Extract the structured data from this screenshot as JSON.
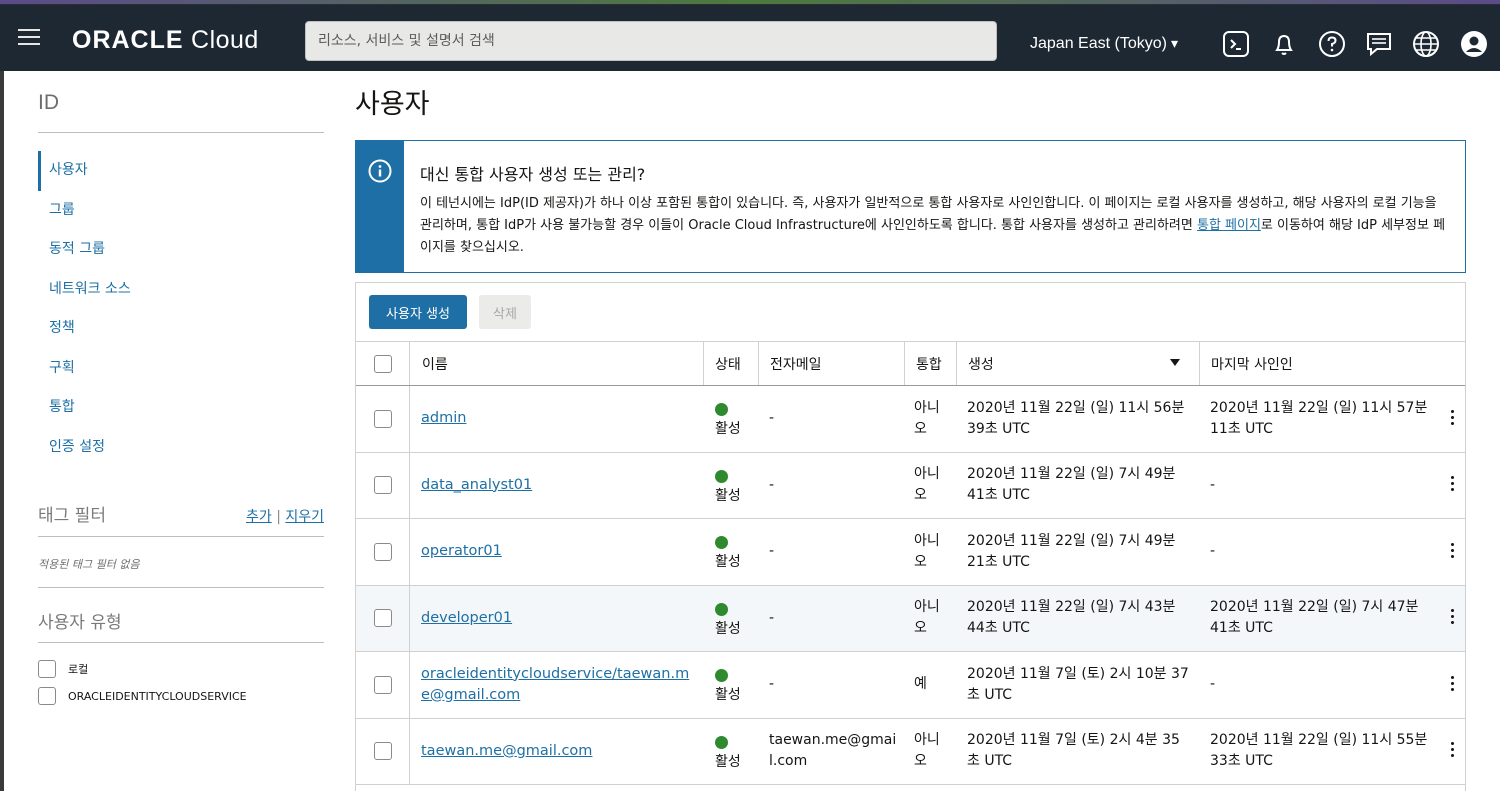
{
  "header": {
    "brand_strong": "ORACLE",
    "brand_light": " Cloud",
    "search_placeholder": "리소스, 서비스 및 설명서 검색",
    "region": "Japan East (Tokyo)"
  },
  "sidebar": {
    "title": "ID",
    "items": [
      {
        "label": "사용자",
        "active": true
      },
      {
        "label": "그룹"
      },
      {
        "label": "동적 그룹"
      },
      {
        "label": "네트워크 소스"
      },
      {
        "label": "정책"
      },
      {
        "label": "구획"
      },
      {
        "label": "통합"
      },
      {
        "label": "인증 설정"
      }
    ],
    "tag_filter_label": "태그 필터",
    "tag_add": "추가",
    "tag_sep": "|",
    "tag_clear": "지우기",
    "no_filter": "적용된 태그 필터 없음",
    "user_type_label": "사용자 유형",
    "user_types": [
      "로컬",
      "ORACLEIDENTITYCLOUDSERVICE"
    ]
  },
  "main": {
    "title": "사용자",
    "info": {
      "heading": "대신 통합 사용자 생성 또는 관리?",
      "body_before": "이 테넌시에는 IdP(ID 제공자)가 하나 이상 포함된 통합이 있습니다. 즉, 사용자가 일반적으로 통합 사용자로 사인인합니다. 이 페이지는 로컬 사용자를 생성하고, 해당 사용자의 로컬 기능을 관리하며, 통합 IdP가 사용 불가능할 경우 이들이 Oracle Cloud Infrastructure에 사인인하도록 합니다. 통합 사용자를 생성하고 관리하려면 ",
      "link": "통합 페이지",
      "body_after": "로 이동하여 해당 IdP 세부정보 페이지를 찾으십시오."
    },
    "create_button": "사용자 생성",
    "delete_button": "삭제",
    "columns": {
      "name": "이름",
      "status": "상태",
      "email": "전자메일",
      "federated": "통합",
      "created": "생성",
      "last_signin": "마지막 사인인"
    },
    "rows": [
      {
        "name": "admin",
        "status": "활성",
        "email": "-",
        "federated": "아니오",
        "created": "2020년 11월 22일 (일) 11시 56분 39초 UTC",
        "last": "2020년 11월 22일 (일) 11시 57분 11초 UTC"
      },
      {
        "name": "data_analyst01",
        "status": "활성",
        "email": "-",
        "federated": "아니오",
        "created": "2020년 11월 22일 (일) 7시 49분 41초 UTC",
        "last": "-"
      },
      {
        "name": "operator01",
        "status": "활성",
        "email": "-",
        "federated": "아니오",
        "created": "2020년 11월 22일 (일) 7시 49분 21초 UTC",
        "last": "-"
      },
      {
        "name": "developer01",
        "status": "활성",
        "email": "-",
        "federated": "아니오",
        "created": "2020년 11월 22일 (일) 7시 43분 44초 UTC",
        "last": "2020년 11월 22일 (일) 7시 47분 41초 UTC"
      },
      {
        "name": "oracleidentitycloudservice/taewan.me@gmail.com",
        "status": "활성",
        "email": "-",
        "federated": "예",
        "created": "2020년 11월 7일 (토) 2시 10분 37초 UTC",
        "last": "-"
      },
      {
        "name": "taewan.me@gmail.com",
        "status": "활성",
        "email": "taewan.me@gmail.com",
        "federated": "아니오",
        "created": "2020년 11월 7일 (토) 2시 4분 35초 UTC",
        "last": "2020년 11월 22일 (일) 11시 55분 33초 UTC"
      }
    ]
  },
  "colors": {
    "topbar": "#1d2833",
    "accent": "#1d6fa5",
    "status_active": "#2f8a2f"
  }
}
